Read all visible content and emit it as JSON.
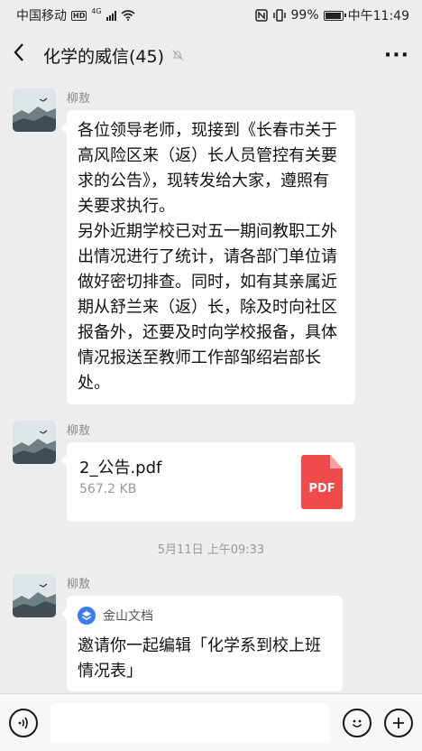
{
  "status_bar": {
    "carrier": "中国移动",
    "network_badge": "HD",
    "network_type": "4G",
    "battery": "99%",
    "time": "中午11:49"
  },
  "nav": {
    "title": "化学的威信(45)",
    "back_icon": "chevron-left-icon",
    "mute_icon": "bell-off-icon",
    "more_icon": "more-dots-icon",
    "more_label": "···"
  },
  "messages": [
    {
      "sender": "柳敖",
      "type": "text",
      "text": "各位领导老师，现接到《长春市关于高风险区来（返）长人员管控有关要求的公告》，现转发给大家，遵照有关要求执行。\n另外近期学校已对五一期间教职工外出情况进行了统计，请各部门单位请做好密切排查。同时，如有其亲属近期从舒兰来（返）长，除及时向社区报备外，还要及时向学校报备，具体情况报送至教师工作部邹绍岩部长处。"
    },
    {
      "sender": "柳敖",
      "type": "file",
      "file_name": "2_公告.pdf",
      "file_size": "567.2 KB",
      "file_badge": "PDF"
    },
    {
      "sender": "柳敖",
      "type": "card",
      "app_name": "金山文档",
      "title": "邀请你一起编辑「化学系到校上班情况表」"
    }
  ],
  "timestamp": "5月11日 上午09:33",
  "input_bar": {
    "voice_icon": "voice-icon",
    "emoji_icon": "emoji-icon",
    "plus_icon": "plus-icon",
    "input_value": ""
  },
  "colors": {
    "background": "#ededed",
    "bubble": "#ffffff",
    "pdf_red": "#f04b4b",
    "app_blue": "#3b7cf0"
  }
}
